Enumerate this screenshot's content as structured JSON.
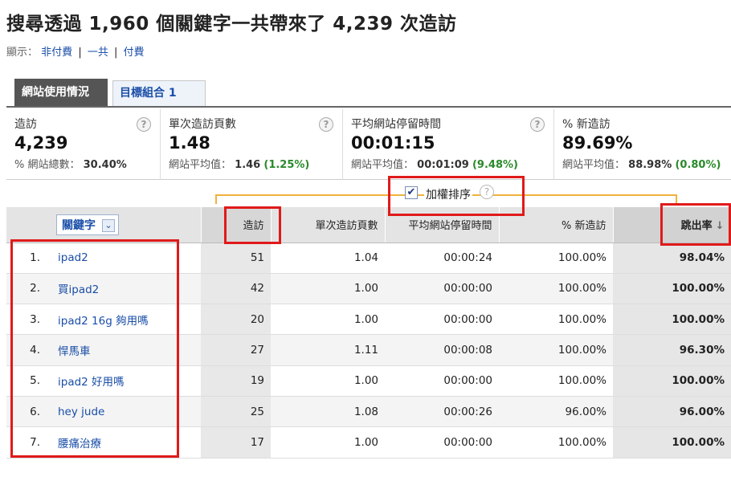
{
  "title": "搜尋透過 1,960 個關鍵字一共帶來了 4,239 次造訪",
  "display": {
    "label": "顯示：",
    "links": [
      "非付費",
      "一共",
      "付費"
    ],
    "separator": "|"
  },
  "tabs": [
    {
      "label": "網站使用情況",
      "active": true
    },
    {
      "label": "目標組合 1",
      "active": false
    }
  ],
  "metrics": [
    {
      "label": "造訪",
      "value": "4,239",
      "sub_label": "% 網站總數：",
      "sub_value": "30.40%",
      "sub_delta": ""
    },
    {
      "label": "單次造訪頁數",
      "value": "1.48",
      "sub_label": "網站平均值：",
      "sub_value": "1.46",
      "sub_delta": "(1.25%)"
    },
    {
      "label": "平均網站停留時間",
      "value": "00:01:15",
      "sub_label": "網站平均值：",
      "sub_value": "00:01:09",
      "sub_delta": "(9.48%)"
    },
    {
      "label": "% 新造訪",
      "value": "89.69%",
      "sub_label": "網站平均值：",
      "sub_value": "88.98%",
      "sub_delta": "(0.80%)"
    }
  ],
  "help_glyph": "?",
  "weighted_sort": {
    "label": "加權排序",
    "checked": true,
    "check_glyph": "✔"
  },
  "table": {
    "columns": {
      "keyword": "關鍵字",
      "visits": "造訪",
      "pages_per_visit": "單次造訪頁數",
      "avg_time": "平均網站停留時間",
      "new_visits": "% 新造訪",
      "bounce_rate": "跳出率"
    },
    "dropdown_glyph": "⌄",
    "sort_glyph": "↓",
    "rows": [
      {
        "num": "1.",
        "keyword": "ipad2",
        "visits": "51",
        "pages": "1.04",
        "time": "00:00:24",
        "new": "100.00%",
        "bounce": "98.04%"
      },
      {
        "num": "2.",
        "keyword": "買ipad2",
        "visits": "42",
        "pages": "1.00",
        "time": "00:00:00",
        "new": "100.00%",
        "bounce": "100.00%"
      },
      {
        "num": "3.",
        "keyword": "ipad2 16g 夠用嗎",
        "visits": "20",
        "pages": "1.00",
        "time": "00:00:00",
        "new": "100.00%",
        "bounce": "100.00%"
      },
      {
        "num": "4.",
        "keyword": "悍馬車",
        "visits": "27",
        "pages": "1.11",
        "time": "00:00:08",
        "new": "100.00%",
        "bounce": "96.30%"
      },
      {
        "num": "5.",
        "keyword": "ipad2 好用嗎",
        "visits": "19",
        "pages": "1.00",
        "time": "00:00:00",
        "new": "100.00%",
        "bounce": "100.00%"
      },
      {
        "num": "6.",
        "keyword": "hey jude",
        "visits": "25",
        "pages": "1.08",
        "time": "00:00:26",
        "new": "96.00%",
        "bounce": "96.00%"
      },
      {
        "num": "7.",
        "keyword": "腰痛治療",
        "visits": "17",
        "pages": "1.00",
        "time": "00:00:00",
        "new": "100.00%",
        "bounce": "100.00%"
      }
    ]
  },
  "colors": {
    "link": "#1a4ea8",
    "highlight_box": "#e01a1a",
    "positive_delta": "#2a8a2a",
    "bracket": "#f0b23c"
  }
}
